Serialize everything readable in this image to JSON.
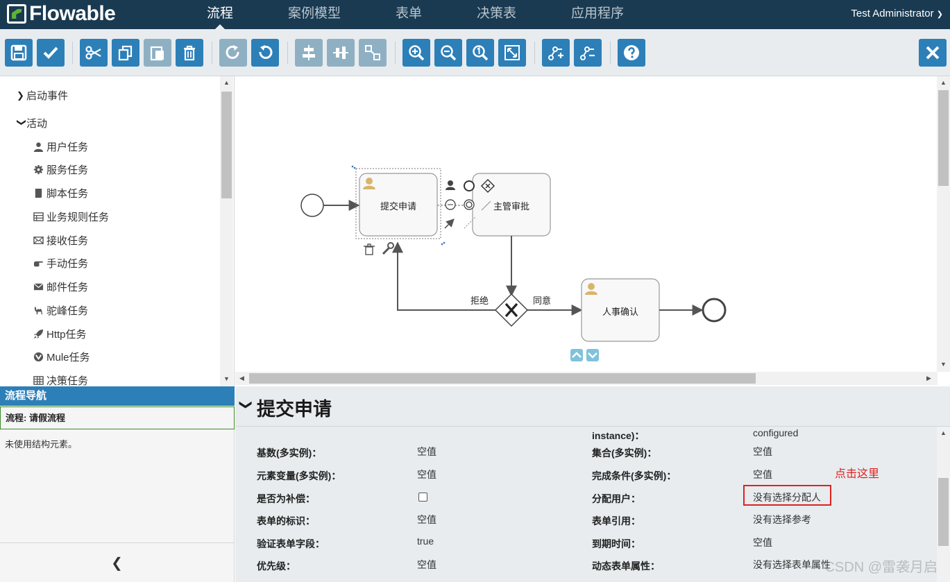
{
  "app": {
    "logo_text": "Flowable",
    "nav_tabs": [
      "流程",
      "案例模型",
      "表单",
      "决策表",
      "应用程序"
    ],
    "active_tab": "流程",
    "user": "Test Administrator"
  },
  "toolbar": {
    "buttons": [
      {
        "icon": "save-icon",
        "enabled": true
      },
      {
        "icon": "check-icon",
        "enabled": true
      },
      {
        "icon": "cut-icon",
        "enabled": true
      },
      {
        "icon": "copy-icon",
        "enabled": true
      },
      {
        "icon": "paste-icon",
        "enabled": false
      },
      {
        "icon": "delete-icon",
        "enabled": true
      },
      {
        "icon": "redo-icon",
        "enabled": false
      },
      {
        "icon": "undo-icon",
        "enabled": true
      },
      {
        "icon": "align-horizontal-icon",
        "enabled": false
      },
      {
        "icon": "align-vertical-icon",
        "enabled": false
      },
      {
        "icon": "same-size-icon",
        "enabled": false
      },
      {
        "icon": "zoom-in-icon",
        "enabled": true
      },
      {
        "icon": "zoom-out-icon",
        "enabled": true
      },
      {
        "icon": "zoom-actual-icon",
        "enabled": true
      },
      {
        "icon": "zoom-fit-icon",
        "enabled": true
      },
      {
        "icon": "add-bendpoint-icon",
        "enabled": true
      },
      {
        "icon": "remove-bendpoint-icon",
        "enabled": true
      },
      {
        "icon": "help-icon",
        "enabled": true
      },
      {
        "icon": "close-icon",
        "enabled": true
      }
    ]
  },
  "palette": {
    "groups": [
      {
        "label": "启动事件",
        "expanded": false
      },
      {
        "label": "活动",
        "expanded": true
      }
    ],
    "items": [
      {
        "label": "用户任务",
        "icon": "user-icon"
      },
      {
        "label": "服务任务",
        "icon": "gear-icon"
      },
      {
        "label": "脚本任务",
        "icon": "script-icon"
      },
      {
        "label": "业务规则任务",
        "icon": "table-icon"
      },
      {
        "label": "接收任务",
        "icon": "envelope-open-icon"
      },
      {
        "label": "手动任务",
        "icon": "hand-icon"
      },
      {
        "label": "邮件任务",
        "icon": "envelope-icon"
      },
      {
        "label": "驼峰任务",
        "icon": "camel-icon"
      },
      {
        "label": "Http任务",
        "icon": "rocket-icon"
      },
      {
        "label": "Mule任务",
        "icon": "mule-icon"
      },
      {
        "label": "决策任务",
        "icon": "grid-icon"
      }
    ]
  },
  "navigator": {
    "header": "流程导航",
    "process_row": "流程: 请假流程",
    "note": "未使用结构元素。"
  },
  "diagram": {
    "tasks": {
      "submit": "提交申请",
      "manager": "主管审批",
      "hr": "人事确认"
    },
    "flows": {
      "reject": "拒绝",
      "approve": "同意"
    }
  },
  "properties": {
    "title": "提交申请",
    "left": [
      {
        "label": "基数(多实例)：",
        "value": "空值"
      },
      {
        "label": "元素变量(多实例)：",
        "value": "空值"
      },
      {
        "label": "是否为补偿：",
        "value": ""
      },
      {
        "label": "表单的标识：",
        "value": "空值"
      },
      {
        "label": "验证表单字段：",
        "value": "true"
      },
      {
        "label": "优先级：",
        "value": "空值"
      }
    ],
    "right": [
      {
        "label": "instance)：",
        "value": "configured"
      },
      {
        "label": "集合(多实例)：",
        "value": "空值"
      },
      {
        "label": "完成条件(多实例)：",
        "value": "空值"
      },
      {
        "label": "分配用户：",
        "value": "没有选择分配人"
      },
      {
        "label": "表单引用：",
        "value": "没有选择参考"
      },
      {
        "label": "到期时间：",
        "value": "空值"
      },
      {
        "label": "动态表单属性：",
        "value": "没有选择表单属性"
      }
    ],
    "compensation_checked": false,
    "hint": "点击这里",
    "watermark": "CSDN @雷袭月启"
  },
  "colors": {
    "nav_bg": "#1a3a52",
    "button_blue": "#2d7fb8",
    "highlight_red": "#e02020"
  }
}
